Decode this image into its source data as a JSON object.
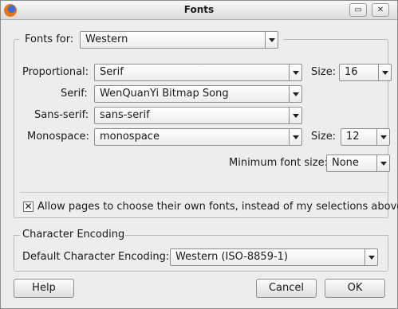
{
  "window": {
    "title": "Fonts"
  },
  "fonts_for": {
    "label": "Fonts for:",
    "value": "Western"
  },
  "proportional": {
    "label": "Proportional:",
    "value": "Serif",
    "size_label": "Size:",
    "size_value": "16"
  },
  "serif": {
    "label": "Serif:",
    "value": "WenQuanYi Bitmap Song"
  },
  "sans_serif": {
    "label": "Sans-serif:",
    "value": "sans-serif"
  },
  "monospace": {
    "label": "Monospace:",
    "value": "monospace",
    "size_label": "Size:",
    "size_value": "12"
  },
  "minimum_font_size": {
    "label": "Minimum font size:",
    "value": "None"
  },
  "allow_pages": {
    "checked": true,
    "label": "Allow pages to choose their own fonts, instead of my selections above"
  },
  "character_encoding": {
    "heading": "Character Encoding",
    "label": "Default Character Encoding:",
    "value": "Western (ISO-8859-1)"
  },
  "buttons": {
    "help": "Help",
    "cancel": "Cancel",
    "ok": "OK"
  },
  "icons": {
    "app": "firefox-icon",
    "minimize": "minimize-icon",
    "close": "close-icon"
  }
}
